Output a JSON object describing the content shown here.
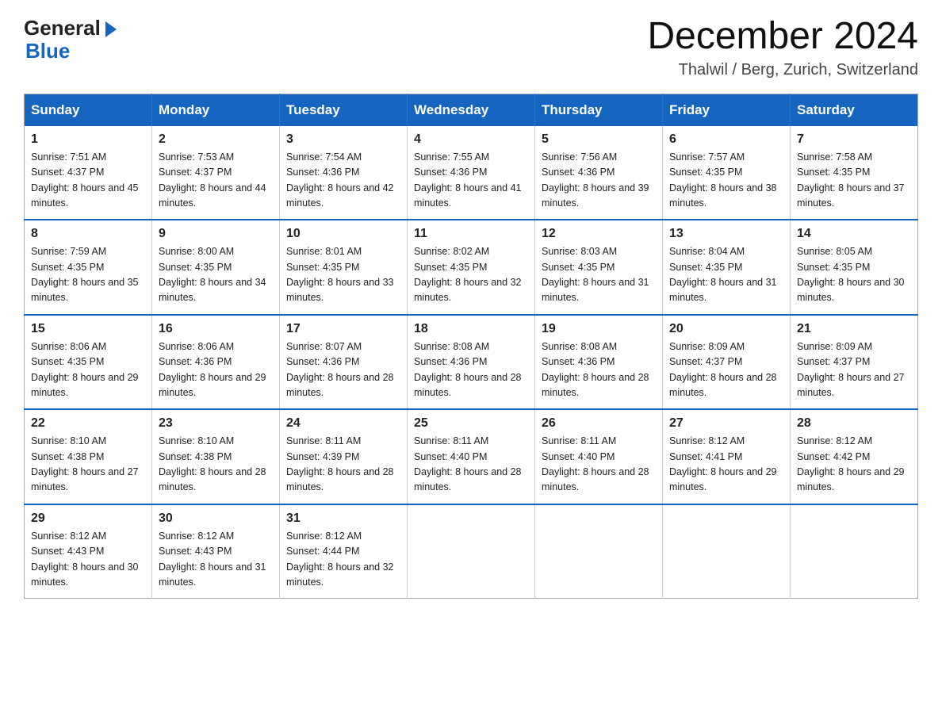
{
  "header": {
    "logo_general": "General",
    "logo_blue": "Blue",
    "month_title": "December 2024",
    "location": "Thalwil / Berg, Zurich, Switzerland"
  },
  "days_of_week": [
    "Sunday",
    "Monday",
    "Tuesday",
    "Wednesday",
    "Thursday",
    "Friday",
    "Saturday"
  ],
  "weeks": [
    [
      {
        "day": "1",
        "sunrise": "7:51 AM",
        "sunset": "4:37 PM",
        "daylight": "8 hours and 45 minutes."
      },
      {
        "day": "2",
        "sunrise": "7:53 AM",
        "sunset": "4:37 PM",
        "daylight": "8 hours and 44 minutes."
      },
      {
        "day": "3",
        "sunrise": "7:54 AM",
        "sunset": "4:36 PM",
        "daylight": "8 hours and 42 minutes."
      },
      {
        "day": "4",
        "sunrise": "7:55 AM",
        "sunset": "4:36 PM",
        "daylight": "8 hours and 41 minutes."
      },
      {
        "day": "5",
        "sunrise": "7:56 AM",
        "sunset": "4:36 PM",
        "daylight": "8 hours and 39 minutes."
      },
      {
        "day": "6",
        "sunrise": "7:57 AM",
        "sunset": "4:35 PM",
        "daylight": "8 hours and 38 minutes."
      },
      {
        "day": "7",
        "sunrise": "7:58 AM",
        "sunset": "4:35 PM",
        "daylight": "8 hours and 37 minutes."
      }
    ],
    [
      {
        "day": "8",
        "sunrise": "7:59 AM",
        "sunset": "4:35 PM",
        "daylight": "8 hours and 35 minutes."
      },
      {
        "day": "9",
        "sunrise": "8:00 AM",
        "sunset": "4:35 PM",
        "daylight": "8 hours and 34 minutes."
      },
      {
        "day": "10",
        "sunrise": "8:01 AM",
        "sunset": "4:35 PM",
        "daylight": "8 hours and 33 minutes."
      },
      {
        "day": "11",
        "sunrise": "8:02 AM",
        "sunset": "4:35 PM",
        "daylight": "8 hours and 32 minutes."
      },
      {
        "day": "12",
        "sunrise": "8:03 AM",
        "sunset": "4:35 PM",
        "daylight": "8 hours and 31 minutes."
      },
      {
        "day": "13",
        "sunrise": "8:04 AM",
        "sunset": "4:35 PM",
        "daylight": "8 hours and 31 minutes."
      },
      {
        "day": "14",
        "sunrise": "8:05 AM",
        "sunset": "4:35 PM",
        "daylight": "8 hours and 30 minutes."
      }
    ],
    [
      {
        "day": "15",
        "sunrise": "8:06 AM",
        "sunset": "4:35 PM",
        "daylight": "8 hours and 29 minutes."
      },
      {
        "day": "16",
        "sunrise": "8:06 AM",
        "sunset": "4:36 PM",
        "daylight": "8 hours and 29 minutes."
      },
      {
        "day": "17",
        "sunrise": "8:07 AM",
        "sunset": "4:36 PM",
        "daylight": "8 hours and 28 minutes."
      },
      {
        "day": "18",
        "sunrise": "8:08 AM",
        "sunset": "4:36 PM",
        "daylight": "8 hours and 28 minutes."
      },
      {
        "day": "19",
        "sunrise": "8:08 AM",
        "sunset": "4:36 PM",
        "daylight": "8 hours and 28 minutes."
      },
      {
        "day": "20",
        "sunrise": "8:09 AM",
        "sunset": "4:37 PM",
        "daylight": "8 hours and 28 minutes."
      },
      {
        "day": "21",
        "sunrise": "8:09 AM",
        "sunset": "4:37 PM",
        "daylight": "8 hours and 27 minutes."
      }
    ],
    [
      {
        "day": "22",
        "sunrise": "8:10 AM",
        "sunset": "4:38 PM",
        "daylight": "8 hours and 27 minutes."
      },
      {
        "day": "23",
        "sunrise": "8:10 AM",
        "sunset": "4:38 PM",
        "daylight": "8 hours and 28 minutes."
      },
      {
        "day": "24",
        "sunrise": "8:11 AM",
        "sunset": "4:39 PM",
        "daylight": "8 hours and 28 minutes."
      },
      {
        "day": "25",
        "sunrise": "8:11 AM",
        "sunset": "4:40 PM",
        "daylight": "8 hours and 28 minutes."
      },
      {
        "day": "26",
        "sunrise": "8:11 AM",
        "sunset": "4:40 PM",
        "daylight": "8 hours and 28 minutes."
      },
      {
        "day": "27",
        "sunrise": "8:12 AM",
        "sunset": "4:41 PM",
        "daylight": "8 hours and 29 minutes."
      },
      {
        "day": "28",
        "sunrise": "8:12 AM",
        "sunset": "4:42 PM",
        "daylight": "8 hours and 29 minutes."
      }
    ],
    [
      {
        "day": "29",
        "sunrise": "8:12 AM",
        "sunset": "4:43 PM",
        "daylight": "8 hours and 30 minutes."
      },
      {
        "day": "30",
        "sunrise": "8:12 AM",
        "sunset": "4:43 PM",
        "daylight": "8 hours and 31 minutes."
      },
      {
        "day": "31",
        "sunrise": "8:12 AM",
        "sunset": "4:44 PM",
        "daylight": "8 hours and 32 minutes."
      },
      null,
      null,
      null,
      null
    ]
  ],
  "labels": {
    "sunrise": "Sunrise: ",
    "sunset": "Sunset: ",
    "daylight": "Daylight: "
  }
}
